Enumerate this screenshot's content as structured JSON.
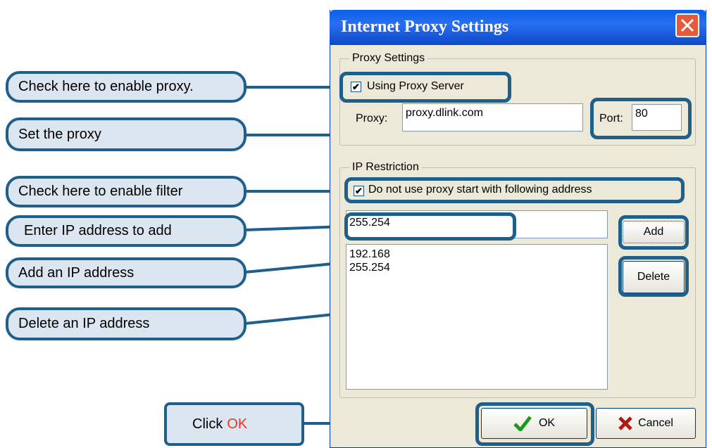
{
  "dialog": {
    "title": "Internet Proxy Settings",
    "proxy_group_label": "Proxy Settings",
    "using_proxy_label": "Using Proxy Server",
    "using_proxy_checked": true,
    "proxy_label": "Proxy:",
    "proxy_value": "proxy.dlink.com",
    "port_label": "Port:",
    "port_value": "80",
    "ip_group_label": "IP Restriction",
    "no_proxy_label": "Do not use proxy start with following address",
    "no_proxy_checked": true,
    "ip_input_value": "255.254",
    "ip_list": [
      "192.168",
      "255.254"
    ],
    "add_label": "Add",
    "delete_label": "Delete",
    "ok_label": "OK",
    "cancel_label": "Cancel"
  },
  "callouts": {
    "enable_proxy": "Check here to enable proxy.",
    "set_proxy": "Set the proxy",
    "enable_filter": "Check here to enable filter",
    "enter_ip": "Enter IP address to add",
    "add_ip": "Add an  IP address",
    "delete_ip": "Delete an IP address",
    "click_ok_prefix": "Click",
    "click_ok_word": "OK"
  },
  "colors": {
    "callout_fill": "#dce6f1",
    "callout_border": "#1f5f8c",
    "title_bar": "#0a5fe8",
    "ok_accent": "#e8342a"
  }
}
